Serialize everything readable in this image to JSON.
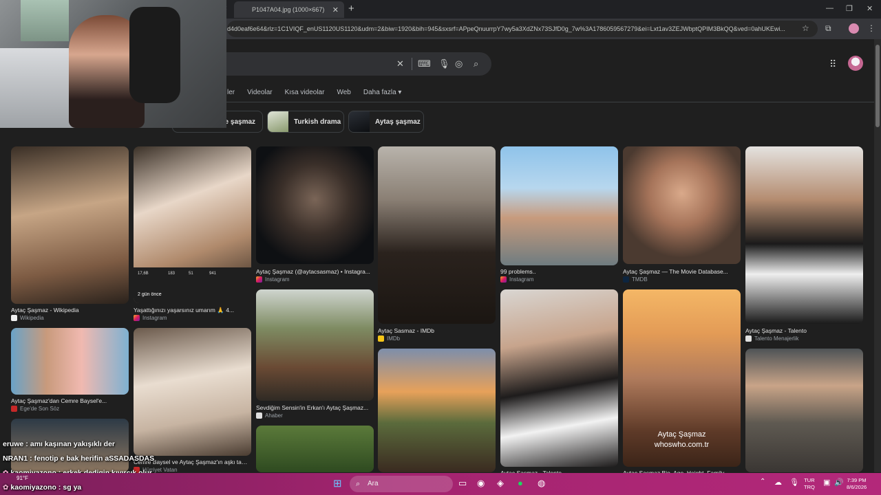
{
  "browser": {
    "tab_title": "P1047A04.jpg (1000×667)",
    "url": "d4d0eaf6e64&rlz=1C1VIQF_enUS1120US1120&udm=2&biw=1920&bih=945&sxsrf=APpeQnuurrpY7wy5a3XdZNx73SJfD0g_7w%3A1786059567279&ei=Lxt1av3ZEJWbptQPIM3BkQQ&ved=0ahUKEwi..."
  },
  "search": {
    "tabs": [
      "ler",
      "Videolar",
      "Kısa videolar",
      "Web",
      "Daha fazla"
    ]
  },
  "chips": [
    {
      "label": "ye şaşmaz"
    },
    {
      "label": "Turkish drama"
    },
    {
      "label": "Aytaş şaşmaz"
    }
  ],
  "results": [
    {
      "title": "Aytaç Şaşmaz - Wikipedia",
      "source": "Wikipedia",
      "favicon": "wikipedia-icon"
    },
    {
      "title": "Aytaç Şaşmaz'dan Cemre Baysel'e...",
      "source": "Ege'de Son Söz",
      "favicon": "news-icon"
    },
    {
      "title": "Yaşattığınızı yaşarsınız umarım 🙏 4...",
      "source": "Instagram",
      "favicon": "instagram-icon",
      "overlay_stats": [
        "17,6B",
        "183",
        "51",
        "941"
      ],
      "overlay_time": "2 gün önce"
    },
    {
      "title": "Cemre Baysel ve Aytaç Şaşmaz'ın aşkı tam...",
      "source": "Hürriyet Vatan",
      "favicon": "news-icon"
    },
    {
      "title": "Aytaç Şaşmaz (@aytacsasmaz) • Instagra...",
      "source": "Instagram",
      "favicon": "instagram-icon"
    },
    {
      "title": "Sevdiğim Sensin'in Erkan'ı Aytaç Şaşmaz...",
      "source": "Ahaber",
      "favicon": "news-icon"
    },
    {
      "title": "Aytaç Sasmaz - IMDb",
      "source": "IMDb",
      "favicon": "imdb-icon"
    },
    {
      "title": "99 problems..",
      "source": "Instagram",
      "favicon": "instagram-icon"
    },
    {
      "title": "Aytaç Şaşmaz - Talento",
      "source": "Talento Menajerlik",
      "favicon": "talento-icon"
    },
    {
      "title": "Aytaç Şaşmaz — The Movie Database...",
      "source": "TMDB",
      "favicon": "tmdb-icon"
    },
    {
      "title": "Aytaç Şaşmaz - Talento",
      "source": "",
      "favicon": ""
    },
    {
      "title": "Aytaç Şaşmaz Bio, Age, Height, Family...",
      "source": "",
      "favicon": "",
      "watermark": [
        "Aytaç Şaşmaz",
        "whoswho.com.tr"
      ]
    }
  ],
  "chat": [
    {
      "user": "eruwe",
      "message": "amı kaşınan yakışıklı der"
    },
    {
      "user": "NRAN1",
      "message": "fenotip e bak herifin aSSADASDAS"
    },
    {
      "user": "kaomiyazono",
      "message": "erkek dedigin kıvırcık olur"
    },
    {
      "user": "kaomiyazono",
      "message": "sg ya"
    }
  ],
  "taskbar": {
    "search_placeholder": "Ara",
    "weather": "91°F",
    "language_top": "TUR",
    "language_bottom": "TRQ",
    "time": "7:39 PM",
    "date": "8/6/2026"
  }
}
